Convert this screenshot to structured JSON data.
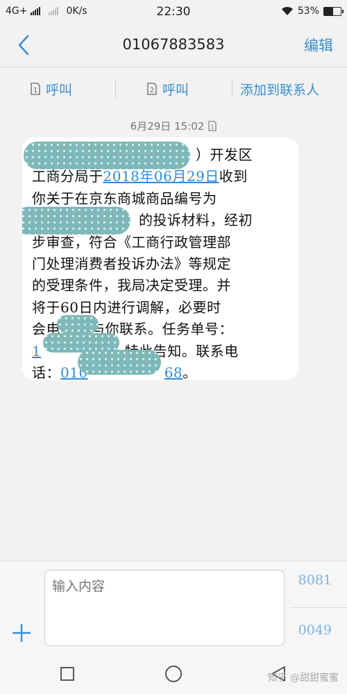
{
  "status_bar": {
    "network": "4G+",
    "speed": "0K/s",
    "time": "22:30",
    "battery": "53%",
    "battery_level": 0.53
  },
  "header": {
    "title": "01067883583",
    "edit_label": "编辑"
  },
  "actions": {
    "call1_label": "呼叫",
    "call2_label": "呼叫",
    "sim1": "1",
    "sim2": "2",
    "add_contact_label": "添加到联系人"
  },
  "message": {
    "timestamp": "6月29日 15:02",
    "sim": "1",
    "line1_tail": "）开发区",
    "line2_prefix": "工商分局于",
    "date_link": "2018年06月29日",
    "line2_suffix": "收到",
    "line3": "你关于在京东商城商品编号为",
    "line4_tail": "的投诉材料，经初",
    "line5": "步审查，符合《工商行政管理部",
    "line6": "门处理消费者投诉办法》等规定",
    "line7": "的受理条件，我局决定受理。并",
    "line8": "将于60日内进行调解，必要时",
    "line9_a": "会电",
    "line9_b": "与你联系。任务单号：",
    "line10_a": "1",
    "line10_b": "。特此告知。联系电",
    "line11_a": "话：",
    "line11_link_a": "010",
    "line11_link_b": "68",
    "line11_end": "。"
  },
  "composer": {
    "placeholder": "输入内容",
    "send_sim1": "8081",
    "send_sim2": "0049"
  },
  "watermark": "知乎 @甜甜蜜蜜"
}
